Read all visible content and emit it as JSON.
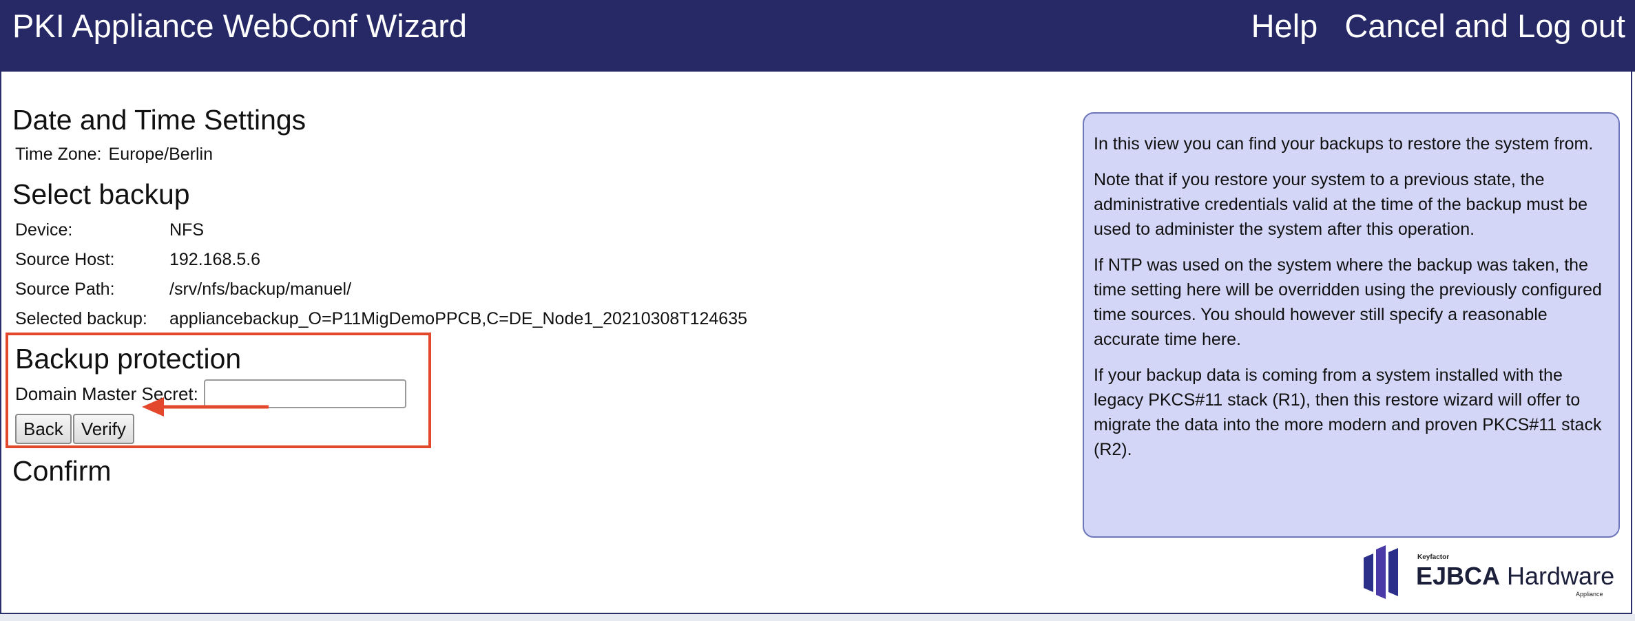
{
  "header": {
    "title": "PKI Appliance WebConf Wizard",
    "help_label": "Help",
    "cancel_label": "Cancel and Log out"
  },
  "datetime": {
    "heading": "Date and Time Settings",
    "timezone_label": "Time Zone:",
    "timezone_value": "Europe/Berlin"
  },
  "backup": {
    "heading": "Select backup",
    "rows": [
      {
        "label": "Device:",
        "value": "NFS"
      },
      {
        "label": "Source Host:",
        "value": "192.168.5.6"
      },
      {
        "label": "Source Path:",
        "value": "/srv/nfs/backup/manuel/"
      },
      {
        "label": "Selected backup:",
        "value": "appliancebackup_O=P11MigDemoPPCB,C=DE_Node1_20210308T124635"
      }
    ]
  },
  "protection": {
    "heading": "Backup protection",
    "secret_label": "Domain Master Secret:",
    "secret_value": "",
    "back_label": "Back",
    "verify_label": "Verify"
  },
  "confirm": {
    "heading": "Confirm"
  },
  "help_panel": {
    "paragraphs": [
      "In this view you can find your backups to restore the system from.",
      "Note that if you restore your system to a previous state, the administrative credentials valid at the time of the backup must be used to administer the system after this operation.",
      "If NTP was used on the system where the backup was taken, the time setting here will be overridden using the previously configured time sources. You should however still specify a reasonable accurate time here.",
      "If your backup data is coming from a system installed with the legacy PKCS#11 stack (R1), then this restore wizard will offer to migrate the data into the more modern and proven PKCS#11 stack (R2)."
    ]
  },
  "logo": {
    "small": "Keyfactor",
    "brand_bold": "EJBCA",
    "brand_light": " Hardware",
    "sub": "Appliance"
  },
  "colors": {
    "header_bg": "#262966",
    "highlight": "#e4482c",
    "help_bg": "#d3d6f6"
  }
}
